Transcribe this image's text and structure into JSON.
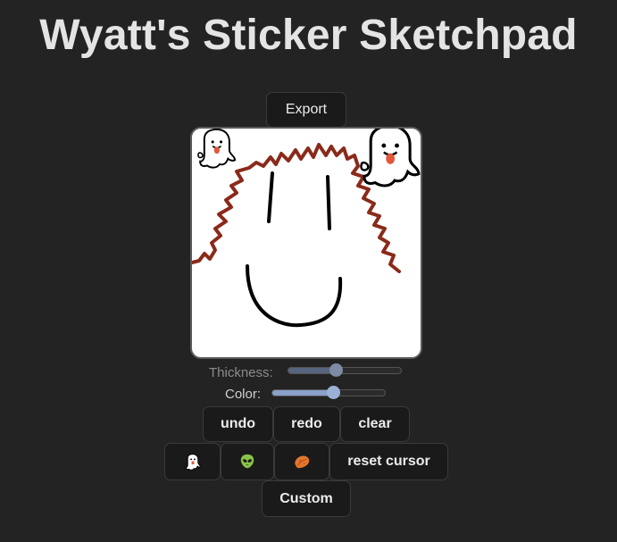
{
  "app": {
    "title": "Wyatt's Sticker Sketchpad"
  },
  "toolbar": {
    "export_label": "Export"
  },
  "controls": {
    "thickness": {
      "label": "Thickness:",
      "value": 0.42
    },
    "color": {
      "label": "Color:",
      "value": 0.54
    }
  },
  "actions": {
    "undo_label": "undo",
    "redo_label": "redo",
    "clear_label": "clear"
  },
  "stickers": {
    "ghost_emoji": "👻",
    "alien_emoji": "👽",
    "sweet_potato_emoji": "🍠",
    "reset_label": "reset cursor"
  },
  "custom_label": "Custom",
  "colors": {
    "background": "#232323",
    "button_bg": "#1a1a1a",
    "hair_stroke": "#8a2a1a",
    "face_stroke": "#000000",
    "thickness_fill": "#56647e",
    "color_fill": "#8aa0c8"
  },
  "canvas_icons": [
    "ghost-sticker-icon",
    "ghost-sticker-icon"
  ]
}
